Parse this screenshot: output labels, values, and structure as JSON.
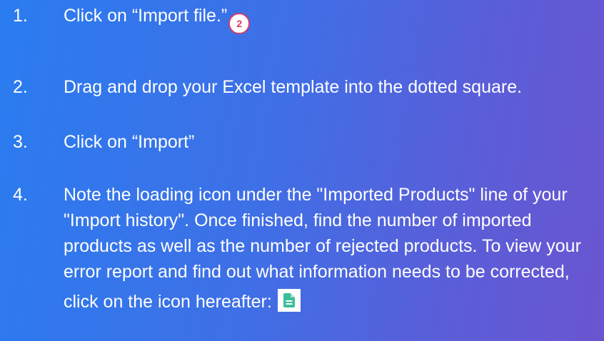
{
  "steps": [
    {
      "number": "1.",
      "text": "Click on “Import file.”",
      "badge": "2"
    },
    {
      "number": "2.",
      "text": "Drag and drop your Excel template into the dotted square."
    },
    {
      "number": "3.",
      "text": "Click on “Import”"
    },
    {
      "number": "4.",
      "text": "Note the loading icon under the \"Imported Products\" line of your \"Import history\". Once finished, find the number of imported products as well as the number of rejected products. To view your error report and find out what information needs to be corrected, click on the icon hereafter:",
      "icon": "report-document-icon"
    }
  ],
  "colors": {
    "background_start": "#2a7cf0",
    "background_end": "#6a55d0",
    "text": "#ffffff",
    "badge": "#d93c6c",
    "document_icon": "#3dbd9a"
  }
}
